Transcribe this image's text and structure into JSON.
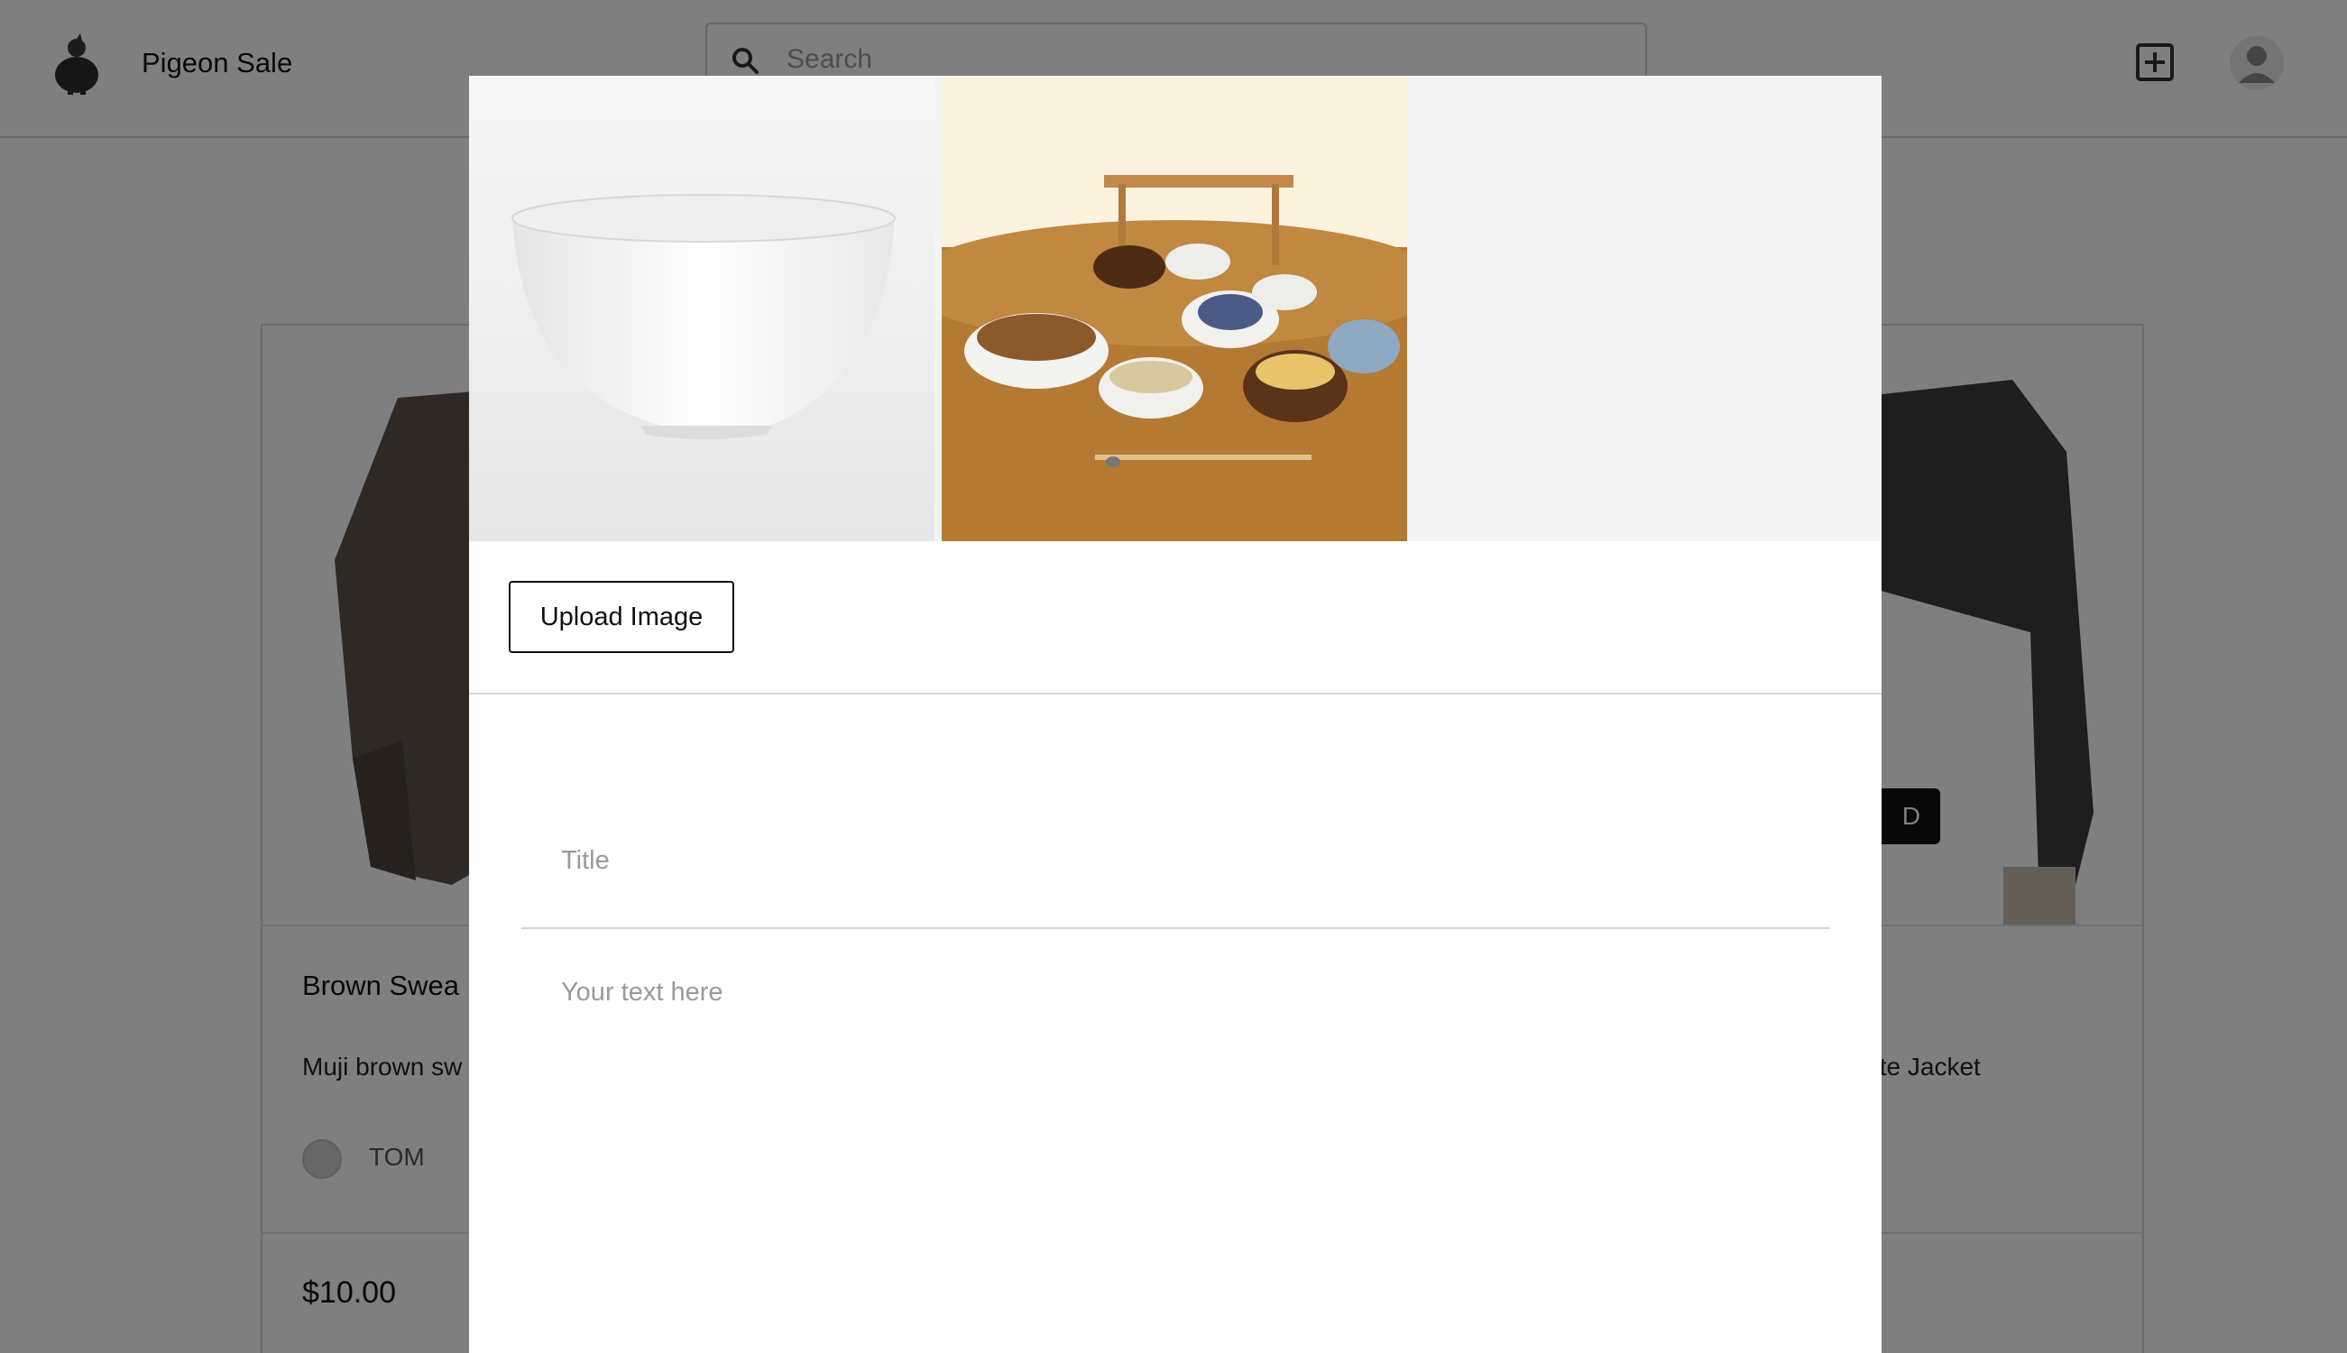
{
  "header": {
    "brand": "Pigeon Sale",
    "search_placeholder": "Search",
    "logo_icon": "pigeon-logo-icon",
    "add_icon": "plus-square-icon",
    "avatar_icon": "user-avatar-icon"
  },
  "background_listings": [
    {
      "title": "Brown Swea",
      "description": "Muji brown sw",
      "user": "TOM",
      "price": "$10.00"
    },
    {
      "description": "tte Jacket",
      "tag": "D"
    }
  ],
  "modal": {
    "images": [
      {
        "alt": "white-bowl"
      },
      {
        "alt": "table-of-dishes"
      }
    ],
    "upload_label": "Upload Image",
    "title_placeholder": "Title",
    "body_placeholder": "Your text here"
  },
  "colors": {
    "overlay": "rgba(0,0,0,0.5)",
    "primary_text": "#111111",
    "placeholder": "#9a9a9a"
  }
}
